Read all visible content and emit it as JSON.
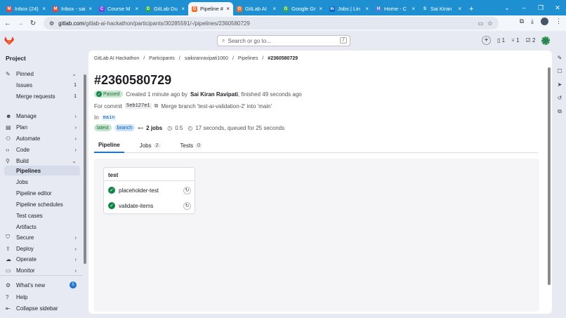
{
  "browser": {
    "tabs": [
      {
        "label": "Inbox (24)",
        "fav_color": "#ea4335",
        "fav_glyph": "M"
      },
      {
        "label": "Inbox - sai",
        "fav_color": "#ea4335",
        "fav_glyph": "M"
      },
      {
        "label": "Course M",
        "fav_color": "#7b3fe4",
        "fav_glyph": "C"
      },
      {
        "label": "GitLab Du",
        "fav_color": "#2da44e",
        "fav_glyph": "D"
      },
      {
        "label": "Pipeline #",
        "fav_color": "#fc6d26",
        "fav_glyph": "G",
        "active": true
      },
      {
        "label": "GitLab AI",
        "fav_color": "#fc6d26",
        "fav_glyph": "G"
      },
      {
        "label": "Google Gr",
        "fav_color": "#34a853",
        "fav_glyph": "G"
      },
      {
        "label": "Jobs | Lin",
        "fav_color": "#0a66c2",
        "fav_glyph": "in"
      },
      {
        "label": "Home - C",
        "fav_color": "#4a7ce0",
        "fav_glyph": "H"
      },
      {
        "label": "Sai Kiran",
        "fav_color": "#1e90d2",
        "fav_glyph": "S"
      }
    ],
    "url_site": "gitlab.com",
    "url_path": "/gitlab-ai-hackathon/participants/30285591/-/pipelines/2360580729"
  },
  "topbar": {
    "search_placeholder": "Search or go to...",
    "search_shortcut": "/",
    "issues_count": "1",
    "mr_count": "1",
    "todo_count": "2"
  },
  "sidebar": {
    "heading": "Project",
    "pinned": "Pinned",
    "issues": {
      "label": "Issues",
      "count": "1"
    },
    "merge_requests": {
      "label": "Merge requests",
      "count": "1"
    },
    "manage": "Manage",
    "plan": "Plan",
    "automate": "Automate",
    "code": "Code",
    "build": "Build",
    "build_items": [
      "Pipelines",
      "Jobs",
      "Pipeline editor",
      "Pipeline schedules",
      "Test cases",
      "Artifacts"
    ],
    "secure": "Secure",
    "deploy": "Deploy",
    "operate": "Operate",
    "monitor": "Monitor",
    "whats_new": "What's new",
    "whats_new_count": "5",
    "help": "Help",
    "collapse": "Collapse sidebar"
  },
  "breadcrumbs": [
    "GitLab AI Hackathon",
    "Participants",
    "saikiranravipati1060",
    "Pipelines",
    "#2360580729"
  ],
  "pipeline": {
    "title": "#2360580729",
    "status": "Passed",
    "created": "Created 1 minute ago by",
    "author": "Sai Kiran Ravipati",
    "finished": ", finished 49 seconds ago",
    "for_commit": "For commit",
    "sha": "5eb127e1",
    "commit_message": "Merge branch 'test-ai-validation-2' into 'main'",
    "in_label": "In",
    "branch": "main",
    "tag_latest": "latest",
    "tag_branch": "branch",
    "jobs_count": "2 jobs",
    "compute": "0.5",
    "duration": "17 seconds, queued for 25 seconds"
  },
  "tabs": [
    {
      "label": "Pipeline",
      "count": ""
    },
    {
      "label": "Jobs",
      "count": "2"
    },
    {
      "label": "Tests",
      "count": "0"
    }
  ],
  "stage": {
    "name": "test",
    "jobs": [
      "placeholder-test",
      "validate-items"
    ]
  }
}
